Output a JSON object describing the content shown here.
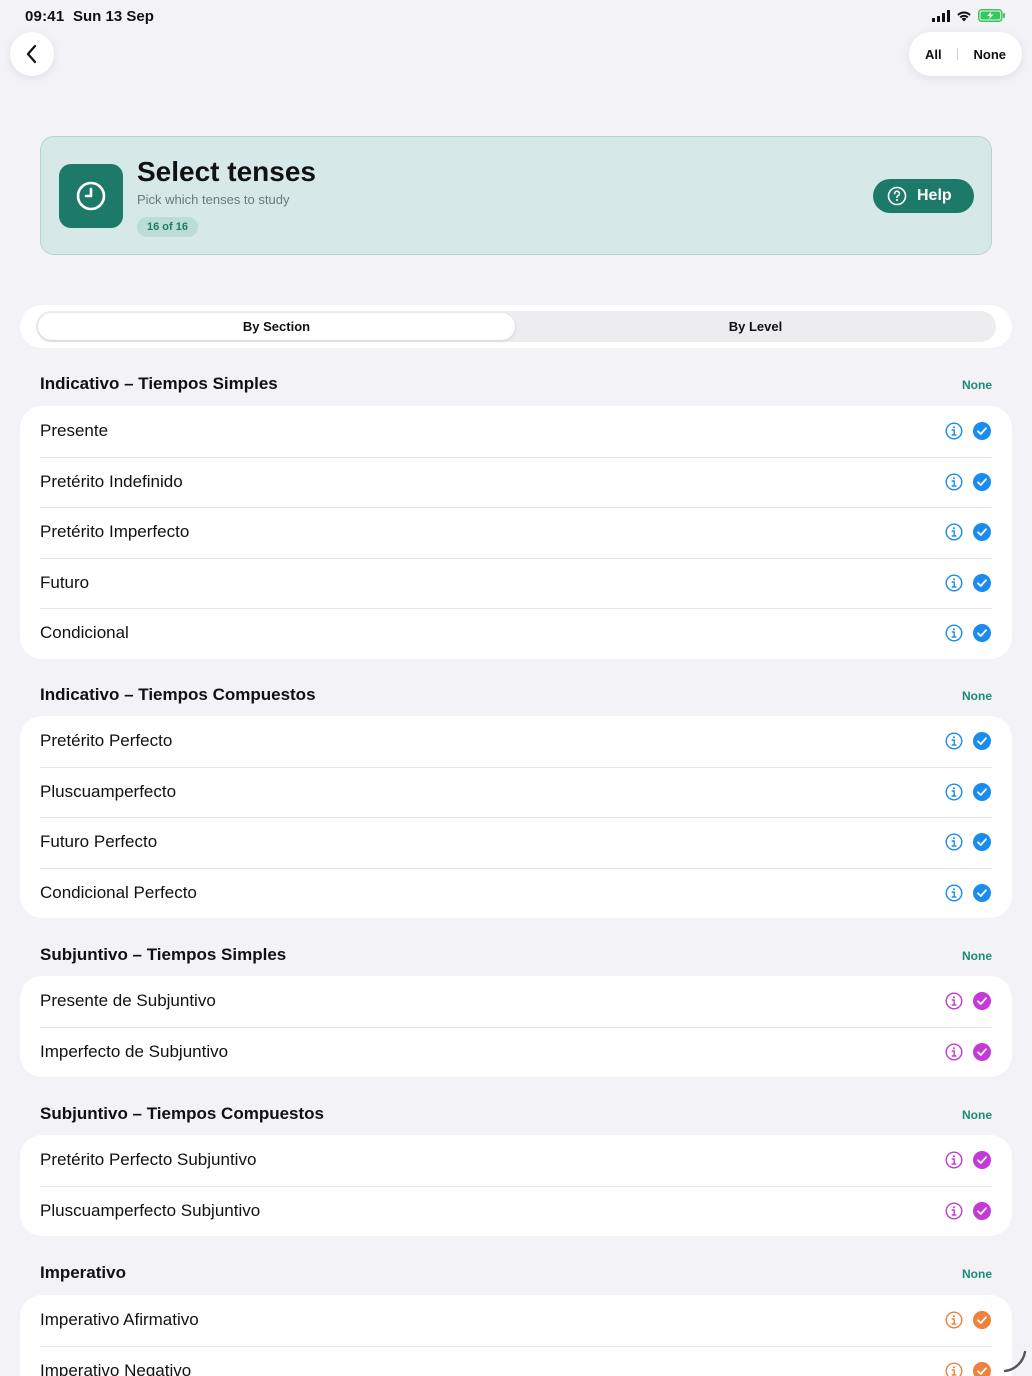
{
  "status": {
    "time": "09:41",
    "date": "Sun 13 Sep"
  },
  "nav": {
    "back_icon": "chevron-left-icon",
    "all_label": "All",
    "none_label": "None"
  },
  "header": {
    "title": "Select tenses",
    "subtitle": "Pick which tenses to study",
    "badge": "16 of 16",
    "icon": "clock-icon",
    "help_label": "Help",
    "color_teal": "#1d7a69"
  },
  "segment": {
    "options": [
      "By Section",
      "By Level"
    ],
    "selected": "By Section"
  },
  "colors": {
    "blue": "#1a8cf0",
    "purple": "#c43ad6",
    "orange": "#f0813a"
  },
  "sections": [
    {
      "title": "Indicativo – Tiempos Simples",
      "action": "None",
      "color": "blue",
      "items": [
        "Presente",
        "Pretérito Indefinido",
        "Pretérito Imperfecto",
        "Futuro",
        "Condicional"
      ]
    },
    {
      "title": "Indicativo – Tiempos Compuestos",
      "action": "None",
      "color": "blue",
      "items": [
        "Pretérito Perfecto",
        "Pluscuamperfecto",
        "Futuro Perfecto",
        "Condicional Perfecto"
      ]
    },
    {
      "title": "Subjuntivo – Tiempos Simples",
      "action": "None",
      "color": "purple",
      "items": [
        "Presente de Subjuntivo",
        "Imperfecto de Subjuntivo"
      ]
    },
    {
      "title": "Subjuntivo – Tiempos Compuestos",
      "action": "None",
      "color": "purple",
      "items": [
        "Pretérito Perfecto Subjuntivo",
        "Pluscuamperfecto Subjuntivo"
      ]
    },
    {
      "title": "Imperativo",
      "action": "None",
      "color": "orange",
      "items": [
        "Imperativo Afirmativo",
        "Imperativo Negativo"
      ]
    }
  ]
}
